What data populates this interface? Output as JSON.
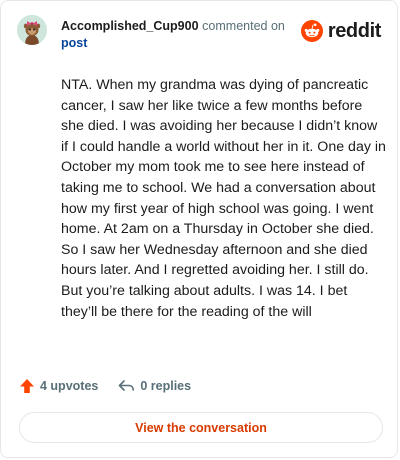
{
  "comment": {
    "author": "Accomplished_Cup900",
    "action_text": "commented on",
    "target_link": "post",
    "body": "NTA. When my grandma was dying of pancreatic cancer, I saw her like twice a few months before she died. I was avoiding her because I didn’t know if I could handle a world without her in it. One day in October my mom took me to see here instead of taking me to school. We had a conversation about how my first year of high school was going. I went home. At 2am on a Thursday in October she died. So I saw her Wednesday afternoon and she died hours later. And I regretted avoiding her. I still do. But you’re talking about adults. I was 14. I bet they’ll be there for the reading of the will"
  },
  "brand": {
    "wordmark": "reddit",
    "color": "#ff4500"
  },
  "actions": {
    "upvotes_label": "4 upvotes",
    "replies_label": "0 replies"
  },
  "cta": {
    "label": "View the conversation"
  },
  "colors": {
    "username": "#1c1c1c",
    "meta": "#576f76",
    "post_link": "#0a449b",
    "upvote_arrow": "#ff4500",
    "cta_text": "#d93a00",
    "border": "#e5e7eb"
  }
}
